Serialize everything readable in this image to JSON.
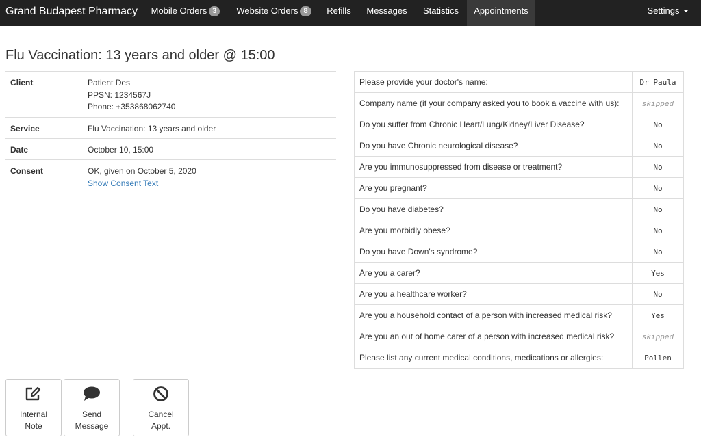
{
  "navbar": {
    "brand": "Grand Budapest Pharmacy",
    "mobile_orders": {
      "label": "Mobile Orders",
      "count": "3"
    },
    "website_orders": {
      "label": "Website Orders",
      "count": "8"
    },
    "refills": "Refills",
    "messages": "Messages",
    "statistics": "Statistics",
    "appointments": "Appointments",
    "settings": "Settings",
    "active_tab": "Appointments",
    "colors": {
      "bar": "#222222",
      "active": "#3a3a3a",
      "badge": "#999999"
    }
  },
  "page": {
    "title": "Flu Vaccination: 13 years and older @ 15:00"
  },
  "details": {
    "client_label": "Client",
    "client_name": "Patient Des",
    "client_ppsn": "PPSN: 1234567J",
    "client_phone": "Phone: +353868062740",
    "service_label": "Service",
    "service_value": "Flu Vaccination: 13 years and older",
    "date_label": "Date",
    "date_value": "October 10, 15:00",
    "consent_label": "Consent",
    "consent_value": "OK, given on October 5, 2020",
    "consent_link": "Show Consent Text"
  },
  "questionnaire": [
    {
      "question": "Please provide your doctor's name:",
      "answer": "Dr Paula",
      "skipped": false
    },
    {
      "question": "Company name (if your company asked you to book a vaccine with us):",
      "answer": "skipped",
      "skipped": true
    },
    {
      "question": "Do you suffer from Chronic Heart/Lung/Kidney/Liver Disease?",
      "answer": "No",
      "skipped": false
    },
    {
      "question": "Do you have Chronic neurological disease?",
      "answer": "No",
      "skipped": false
    },
    {
      "question": "Are you immunosuppressed from disease or treatment?",
      "answer": "No",
      "skipped": false
    },
    {
      "question": "Are you pregnant?",
      "answer": "No",
      "skipped": false
    },
    {
      "question": "Do you have diabetes?",
      "answer": "No",
      "skipped": false
    },
    {
      "question": "Are you morbidly obese?",
      "answer": "No",
      "skipped": false
    },
    {
      "question": "Do you have Down's syndrome?",
      "answer": "No",
      "skipped": false
    },
    {
      "question": "Are you a carer?",
      "answer": "Yes",
      "skipped": false
    },
    {
      "question": "Are you a healthcare worker?",
      "answer": "No",
      "skipped": false
    },
    {
      "question": "Are you a household contact of a person with increased medical risk?",
      "answer": "Yes",
      "skipped": false
    },
    {
      "question": "Are you an out of home carer of a person with increased medical risk?",
      "answer": "skipped",
      "skipped": true
    },
    {
      "question": "Please list any current medical conditions, medications or allergies:",
      "answer": "Pollen",
      "skipped": false
    }
  ],
  "actions": {
    "internal_note": {
      "line1": "Internal",
      "line2": "Note",
      "icon": "edit-icon"
    },
    "send_message": {
      "line1": "Send",
      "line2": "Message",
      "icon": "comment-icon"
    },
    "cancel_appt": {
      "line1": "Cancel",
      "line2": "Appt.",
      "icon": "ban-icon"
    }
  }
}
